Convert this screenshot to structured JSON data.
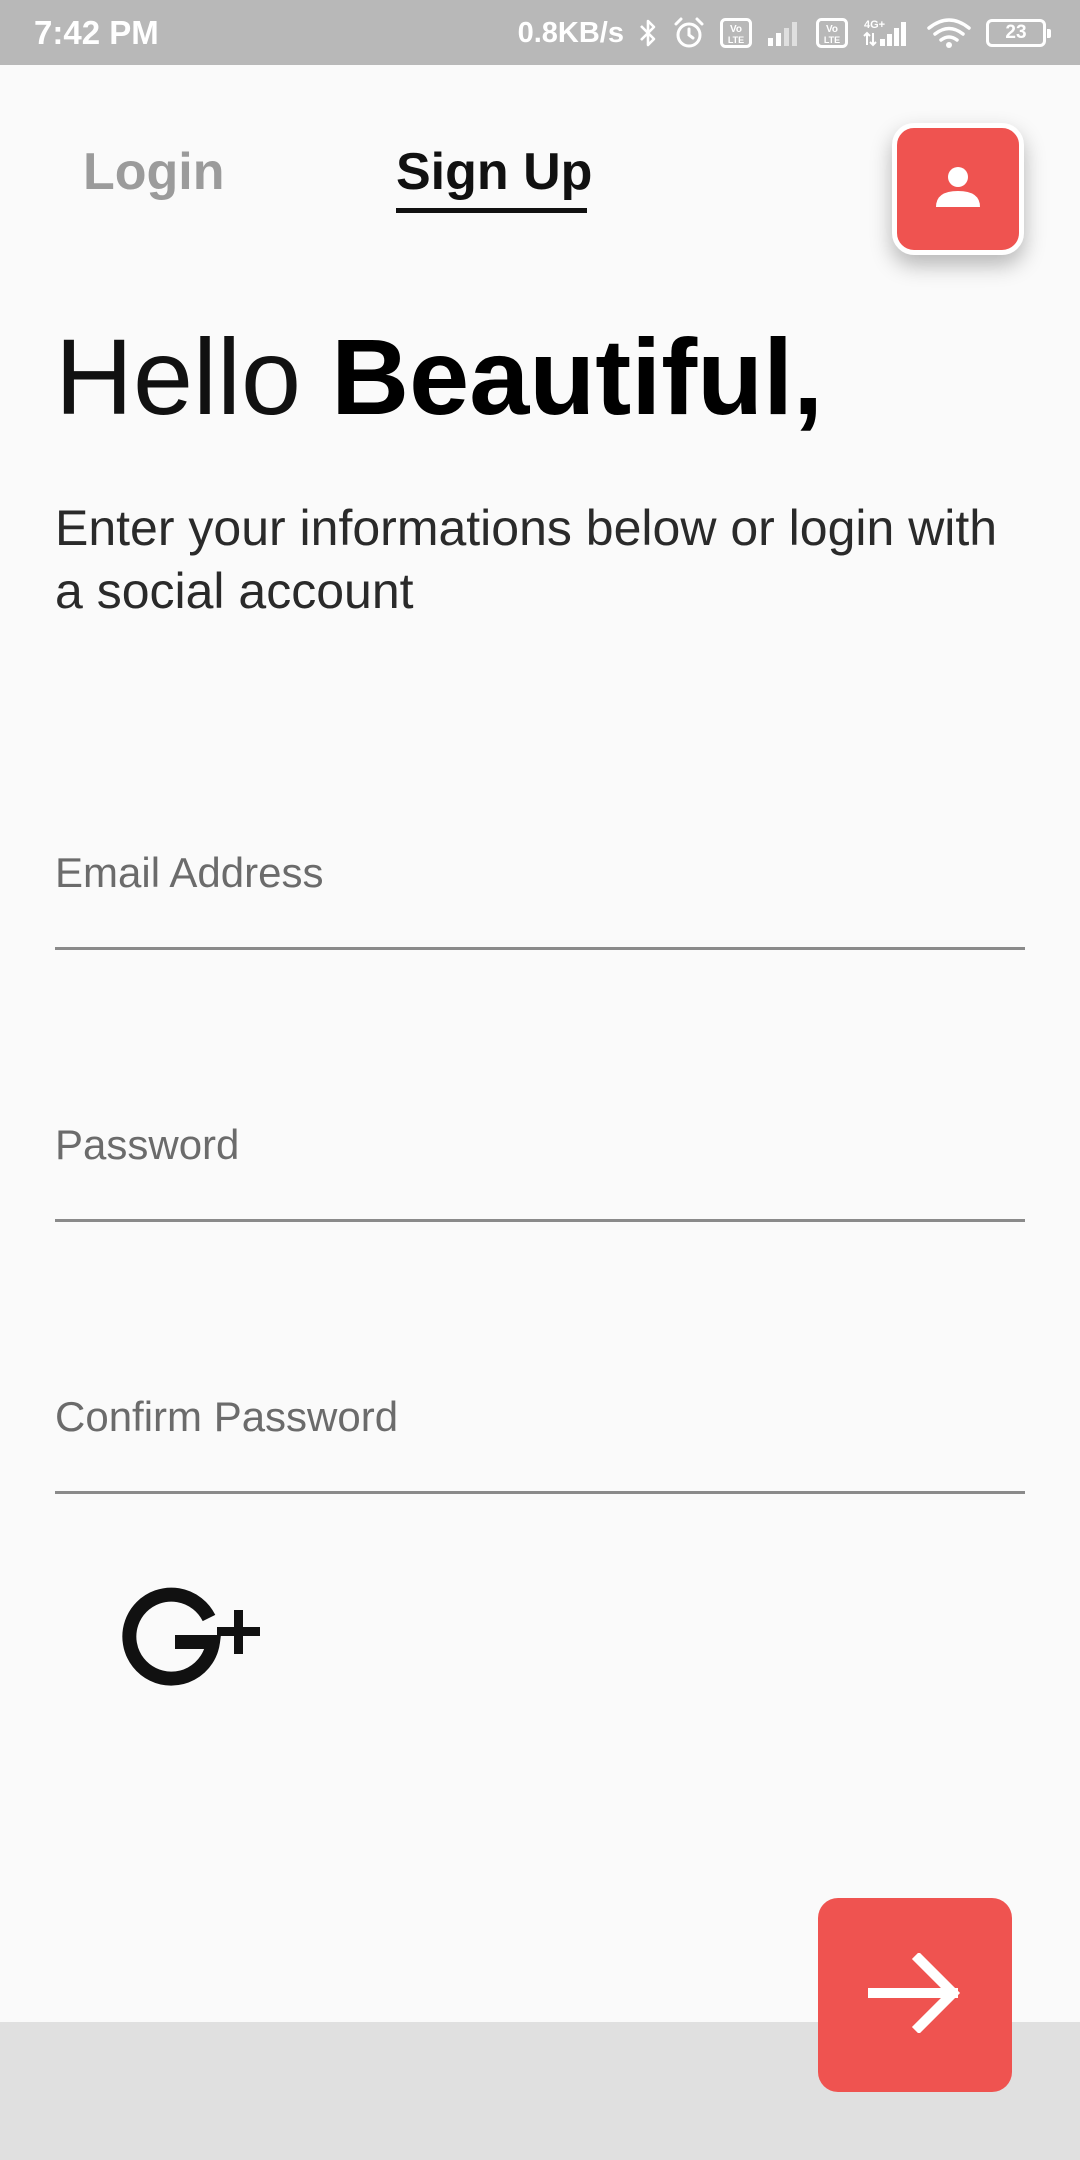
{
  "status_bar": {
    "time": "7:42 PM",
    "net_speed": "0.8KB/s",
    "battery": "23",
    "icons": [
      "bluetooth-icon",
      "alarm-icon",
      "volte-icon",
      "signal-icon",
      "volte-icon",
      "4g-signal-icon",
      "wifi-icon",
      "battery-icon"
    ]
  },
  "tabs": {
    "login": "Login",
    "signup": "Sign Up",
    "active": "signup"
  },
  "profile_button": {
    "icon": "person-icon"
  },
  "headline": {
    "light": "Hello",
    "bold": "Beautiful,"
  },
  "subtitle": "Enter your informations below or login with a social account",
  "form": {
    "email_placeholder": "Email Address",
    "password_placeholder": "Password",
    "confirm_placeholder": "Confirm Password"
  },
  "social": {
    "icon": "google-plus-icon"
  },
  "next_button": {
    "icon": "arrow-right-icon"
  },
  "colors": {
    "accent": "#ef5350",
    "status_bar": "#b8b8b8",
    "background": "#fafafa",
    "bottom_band": "#e0e0e0"
  }
}
